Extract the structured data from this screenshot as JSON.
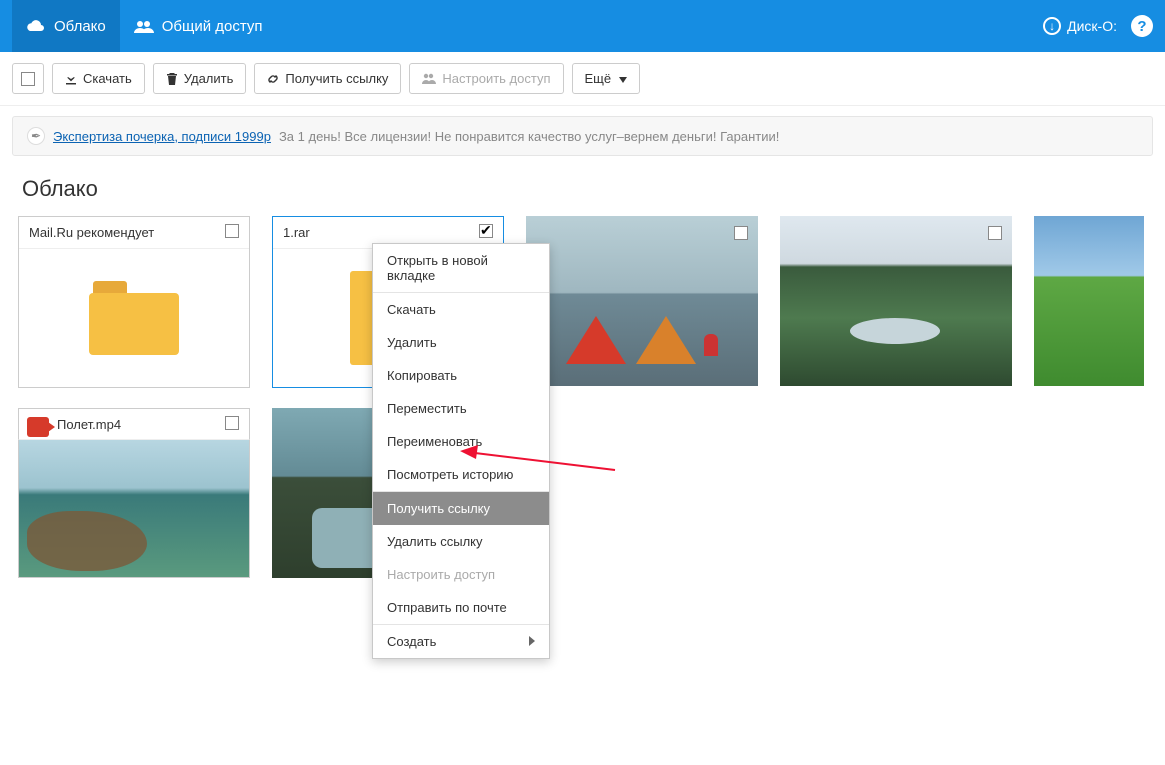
{
  "topbar": {
    "cloud_tab": "Облако",
    "share_tab": "Общий доступ",
    "disk": "Диск-О:"
  },
  "toolbar": {
    "download": "Скачать",
    "delete": "Удалить",
    "get_link": "Получить ссылку",
    "configure": "Настроить доступ",
    "more": "Ещё"
  },
  "ad": {
    "link": "Экспертиза почерка, подписи 1999р",
    "text": "За 1 день! Все лицензии! Не понравится качество услуг–вернем деньги! Гарантии!"
  },
  "page_title": "Облако",
  "tiles": {
    "recommend": "Mail.Ru рекомендует",
    "rar": "1.rar",
    "video": "Полет.mp4"
  },
  "ctx": {
    "open_new_tab": "Открыть в новой вкладке",
    "download": "Скачать",
    "delete": "Удалить",
    "copy": "Копировать",
    "move": "Переместить",
    "rename": "Переименовать",
    "history": "Посмотреть историю",
    "get_link": "Получить ссылку",
    "remove_link": "Удалить ссылку",
    "configure": "Настроить доступ",
    "send_mail": "Отправить по почте",
    "create": "Создать"
  }
}
